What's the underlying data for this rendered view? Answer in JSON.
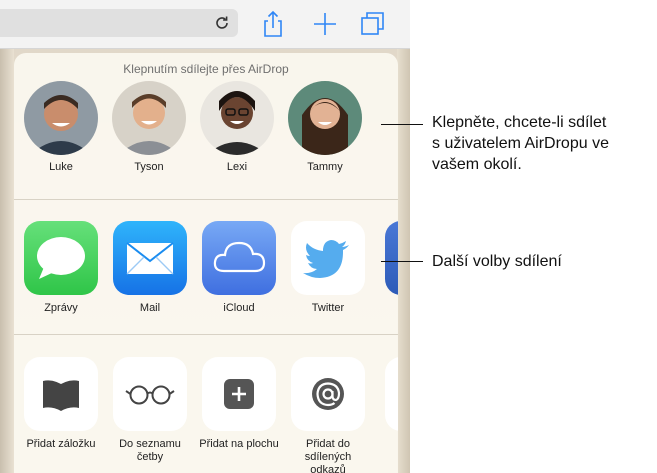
{
  "airdrop": {
    "title": "Klepnutím sdílejte přes AirDrop",
    "people": [
      {
        "name": "Luke"
      },
      {
        "name": "Tyson"
      },
      {
        "name": "Lexi"
      },
      {
        "name": "Tammy"
      }
    ]
  },
  "share_apps": [
    {
      "label": "Zprávy",
      "icon": "messages-icon"
    },
    {
      "label": "Mail",
      "icon": "mail-icon"
    },
    {
      "label": "iCloud",
      "icon": "icloud-icon"
    },
    {
      "label": "Twitter",
      "icon": "twitter-icon"
    }
  ],
  "actions": [
    {
      "label": "Přidat záložku",
      "icon": "bookmark-book-icon"
    },
    {
      "label": "Do seznamu četby",
      "icon": "reading-list-glasses-icon"
    },
    {
      "label": "Přidat na plochu",
      "icon": "add-to-home-icon"
    },
    {
      "label": "Přidat do sdílených odkazů",
      "icon": "shared-links-at-icon"
    }
  ],
  "callouts": {
    "airdrop_lines": [
      "Klepněte, chcete-li sdílet",
      "s uživatelem AirDropu ve",
      "vašem okolí."
    ],
    "more_options": "Další volby sdílení"
  },
  "colors": {
    "messages_green": "#4cd964",
    "mail_blue": "#1a8cf0",
    "icloud_blue": "#5b8ef0",
    "twitter_blue": "#55acee",
    "sheet_bg": "#faf7ee"
  }
}
